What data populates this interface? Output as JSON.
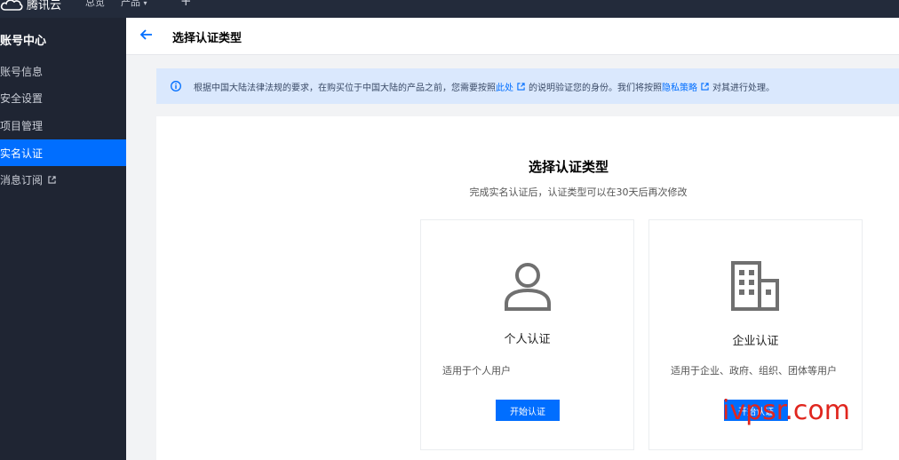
{
  "topbar": {
    "brand": "腾讯云",
    "nav": [
      "总览",
      "产品"
    ],
    "nav_dropdown_icon": "chevron-down-icon",
    "plus": "+"
  },
  "sidebar": {
    "title": "账号中心",
    "items": [
      {
        "label": "账号信息"
      },
      {
        "label": "安全设置"
      },
      {
        "label": "项目管理"
      },
      {
        "label": "实名认证",
        "active": true
      },
      {
        "label": "消息订阅",
        "external": true
      }
    ]
  },
  "header": {
    "back_icon": "arrow-left-icon",
    "title": "选择认证类型"
  },
  "notice": {
    "icon": "info-icon",
    "text_1": "根据中国大陆法律法规的要求，在购买位于中国大陆的产品之前，您需要按照",
    "link_1": "此处",
    "text_2": "的说明验证您的身份。我们将按照",
    "link_2": "隐私策略",
    "text_3": "对其进行处理。"
  },
  "main": {
    "heading": "选择认证类型",
    "subheading": "完成实名认证后，认证类型可以在30天后再次修改",
    "cards": [
      {
        "icon": "user-icon",
        "name": "个人认证",
        "desc": "适用于个人用户",
        "button": "开始认证"
      },
      {
        "icon": "building-icon",
        "name": "企业认证",
        "desc": "适用于企业、政府、组织、团体等用户",
        "button": "开始认证"
      }
    ]
  },
  "watermark": "ivpsr.com",
  "colors": {
    "accent": "#006eff",
    "sidebar_bg": "#1f2533",
    "topbar_bg": "#232b3b",
    "notice_bg": "#dae8fd",
    "watermark": "#e0261e"
  }
}
